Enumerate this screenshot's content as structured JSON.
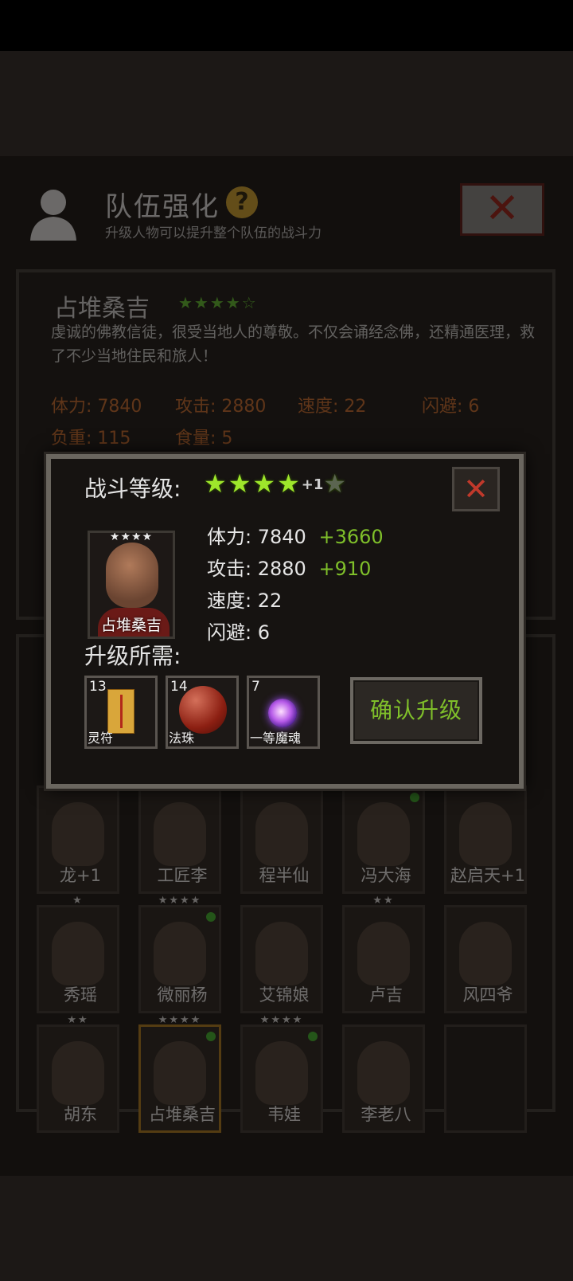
{
  "header": {
    "title": "队伍强化",
    "subtitle": "升级人物可以提升整个队伍的战斗力",
    "help_symbol": "?",
    "close_symbol": "✕"
  },
  "info": {
    "name": "占堆桑吉",
    "stars": "★★★★☆",
    "description": "虔诚的佛教信徒，很受当地人的尊敬。不仅会诵经念佛，还精通医理，救了不少当地住民和旅人！",
    "stats": {
      "stamina": "体力: 7840",
      "attack": "攻击: 2880",
      "speed": "速度: 22",
      "dodge": "闪避: 6",
      "load": "负重: 115",
      "food": "食量: 5"
    }
  },
  "roster": [
    {
      "name": "龙+1",
      "stars": "",
      "dot": false
    },
    {
      "name": "工匠李",
      "stars": "",
      "dot": false
    },
    {
      "name": "程半仙",
      "stars": "",
      "dot": false
    },
    {
      "name": "冯大海",
      "stars": "",
      "dot": true
    },
    {
      "name": "赵启天+1",
      "stars": "",
      "dot": false
    },
    {
      "name": "秀瑶",
      "stars": "★",
      "dot": false
    },
    {
      "name": "微丽杨",
      "stars": "★★★★",
      "dot": true
    },
    {
      "name": "艾锦娘",
      "stars": "",
      "dot": false
    },
    {
      "name": "卢吉",
      "stars": "★★",
      "dot": false
    },
    {
      "name": "风四爷",
      "stars": "",
      "dot": false
    },
    {
      "name": "胡东",
      "stars": "★★",
      "dot": false
    },
    {
      "name": "占堆桑吉",
      "stars": "★★★★",
      "dot": true
    },
    {
      "name": "韦娃",
      "stars": "★★★★",
      "dot": true
    },
    {
      "name": "李老八",
      "stars": "",
      "dot": false
    }
  ],
  "modal": {
    "level_label": "战斗等级:",
    "level_stars_filled": 4,
    "level_stars_total": 5,
    "level_bonus": "+1",
    "close_symbol": "✕",
    "portrait": {
      "stars": "★★★★",
      "name": "占堆桑吉"
    },
    "stats": [
      {
        "label": "体力:",
        "value": "7840",
        "bonus": "+3660"
      },
      {
        "label": "攻击:",
        "value": "2880",
        "bonus": "+910"
      },
      {
        "label": "速度:",
        "value": "22",
        "bonus": ""
      },
      {
        "label": "闪避:",
        "value": "6",
        "bonus": ""
      }
    ],
    "requirements_label": "升级所需:",
    "items": [
      {
        "count": "13",
        "name": "灵符",
        "icon": "talisman-icon"
      },
      {
        "count": "14",
        "name": "法珠",
        "icon": "orb-icon"
      },
      {
        "count": "7",
        "name": "一等魔魂",
        "icon": "soul-icon"
      }
    ],
    "confirm_label": "确认升级"
  },
  "colors": {
    "accent_green": "#7fbf2a",
    "star_green": "#9ee62b",
    "close_red": "#c0392b"
  }
}
